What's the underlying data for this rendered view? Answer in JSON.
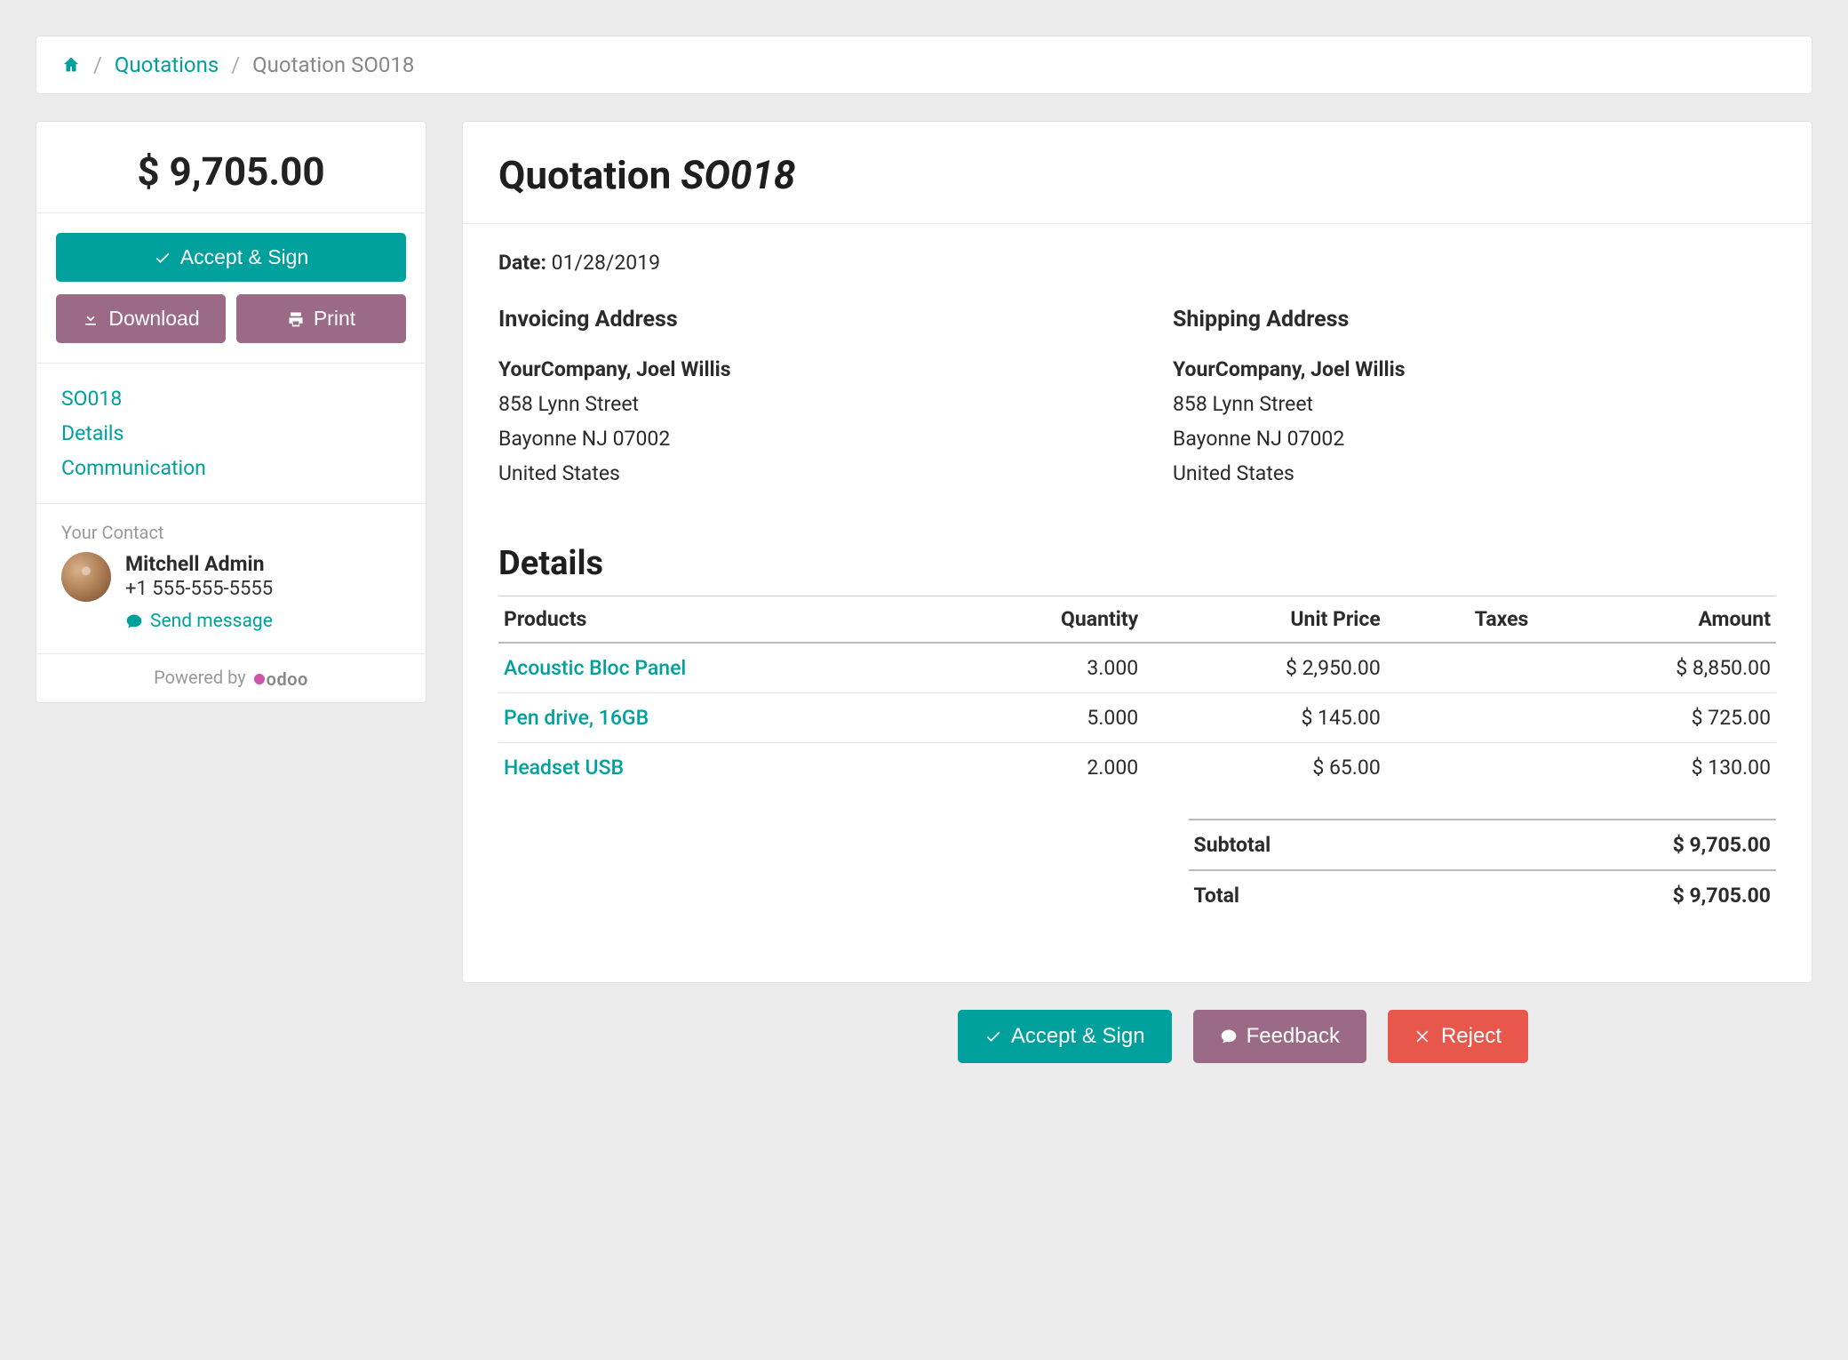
{
  "breadcrumb": {
    "home_label": "Home",
    "items": [
      {
        "label": "Quotations"
      },
      {
        "label": "Quotation SO018"
      }
    ]
  },
  "sidebar": {
    "total": "$ 9,705.00",
    "accept_label": "Accept & Sign",
    "download_label": "Download",
    "print_label": "Print",
    "nav": [
      {
        "label": "SO018"
      },
      {
        "label": "Details"
      },
      {
        "label": "Communication"
      }
    ],
    "contact_label": "Your Contact",
    "contact_name": "Mitchell Admin",
    "contact_phone": "+1 555-555-5555",
    "send_message_label": "Send message",
    "powered_by": "Powered by",
    "brand": "odoo"
  },
  "main": {
    "title_prefix": "Quotation ",
    "title_ref": "SO018",
    "date_label": "Date:",
    "date_value": "01/28/2019",
    "invoicing_heading": "Invoicing Address",
    "shipping_heading": "Shipping Address",
    "address": {
      "company": "YourCompany, Joel Willis",
      "street": "858 Lynn Street",
      "city": "Bayonne NJ 07002",
      "country": "United States"
    },
    "details_heading": "Details",
    "columns": {
      "products": "Products",
      "quantity": "Quantity",
      "unit_price": "Unit Price",
      "taxes": "Taxes",
      "amount": "Amount"
    },
    "lines": [
      {
        "product": "Acoustic Bloc Panel",
        "qty": "3.000",
        "unit_price": "$ 2,950.00",
        "taxes": "",
        "amount": "$ 8,850.00"
      },
      {
        "product": "Pen drive, 16GB",
        "qty": "5.000",
        "unit_price": "$ 145.00",
        "taxes": "",
        "amount": "$ 725.00"
      },
      {
        "product": "Headset USB",
        "qty": "2.000",
        "unit_price": "$ 65.00",
        "taxes": "",
        "amount": "$ 130.00"
      }
    ],
    "subtotal_label": "Subtotal",
    "subtotal_value": "$ 9,705.00",
    "total_label": "Total",
    "total_value": "$ 9,705.00"
  },
  "bottom": {
    "accept_label": "Accept & Sign",
    "feedback_label": "Feedback",
    "reject_label": "Reject"
  }
}
